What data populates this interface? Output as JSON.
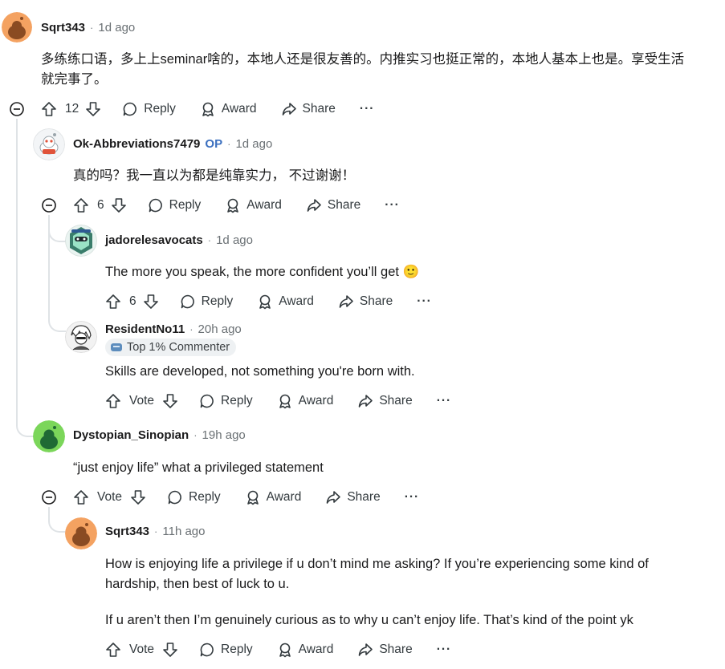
{
  "labels": {
    "reply": "Reply",
    "award": "Award",
    "share": "Share",
    "vote": "Vote",
    "op": "OP",
    "more": "···",
    "separator": "·"
  },
  "comments": [
    {
      "author": "Sqrt343",
      "time": "1d ago",
      "avatar_color": "#f4a261",
      "body": [
        "多练练口语，多上上seminar啥的，本地人还是很友善的。内推实习也挺正常的，本地人基本上也是。享受生活",
        "就完事了。"
      ],
      "votes": "12"
    },
    {
      "author": "Ok-Abbreviations7479",
      "op": true,
      "time": "1d ago",
      "body": [
        "真的吗？我一直以为都是纯靠实力，  不过谢谢！"
      ],
      "votes": "6"
    },
    {
      "author": "jadorelesavocats",
      "time": "1d ago",
      "body": [
        "The more you speak, the more confident you’ll get 🙂"
      ],
      "votes": "6"
    },
    {
      "author": "ResidentNo11",
      "time": "20h ago",
      "badge": "Top 1% Commenter",
      "body": [
        "Skills are developed, not something you're born with."
      ],
      "votes": "Vote"
    },
    {
      "author": "Dystopian_Sinopian",
      "time": "19h ago",
      "avatar_color": "#7bd65a",
      "body": [
        "“just enjoy life” what a privileged statement"
      ],
      "votes": "Vote"
    },
    {
      "author": "Sqrt343",
      "time": "11h ago",
      "avatar_color": "#f4a261",
      "body": [
        "How is enjoying life a privilege if u don’t mind me asking? If you’re experiencing some kind of",
        "hardship, then best of luck to u.",
        "If u aren’t then I’m genuinely curious as to why u can’t enjoy life. That’s kind of the point yk"
      ],
      "votes": "Vote"
    }
  ]
}
